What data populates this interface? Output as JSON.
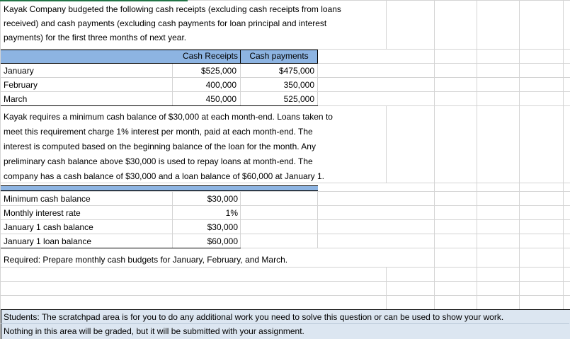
{
  "intro": {
    "line1": "Kayak Company budgeted the following cash receipts (excluding cash receipts from loans",
    "line2": "received) and cash payments (excluding cash payments for loan principal and interest",
    "line3": "payments) for the first three months of next year."
  },
  "budget_table": {
    "headers": [
      "Cash Receipts",
      "Cash payments"
    ],
    "rows": [
      {
        "month": "January",
        "receipts": "$525,000",
        "payments": "$475,000"
      },
      {
        "month": "February",
        "receipts": "400,000",
        "payments": "350,000"
      },
      {
        "month": "March",
        "receipts": "450,000",
        "payments": "525,000"
      }
    ]
  },
  "requirements_text": {
    "line1": "Kayak requires a minimum cash balance of $30,000 at each month-end. Loans taken to",
    "line2": "meet this requirement charge 1% interest per month, paid at each month-end. The",
    "line3": "interest is computed based on the beginning balance of the loan for the month. Any",
    "line4": "preliminary cash balance above $30,000 is used to repay loans at month-end. The",
    "line5": "company has a cash balance of $30,000 and a loan balance of $60,000 at January 1."
  },
  "params": [
    {
      "label": "Minimum cash balance",
      "value": "$30,000"
    },
    {
      "label": "Monthly interest rate",
      "value": "1%"
    },
    {
      "label": "January 1 cash balance",
      "value": "$30,000"
    },
    {
      "label": "January 1 loan balance",
      "value": "$60,000"
    }
  ],
  "required": "Required:  Prepare monthly cash budgets for January, February, and March.",
  "scratchpad": {
    "line1": "Students: The scratchpad area is for you to do any additional work you need to solve this question or can be used to show your work.",
    "line2": "Nothing in this area will be graded, but it will be submitted with your assignment."
  },
  "colors": {
    "header_fill": "#8db4e2",
    "scratch_fill": "#dce6f1",
    "selection_green": "#217346",
    "grid": "#d4d4d4"
  }
}
